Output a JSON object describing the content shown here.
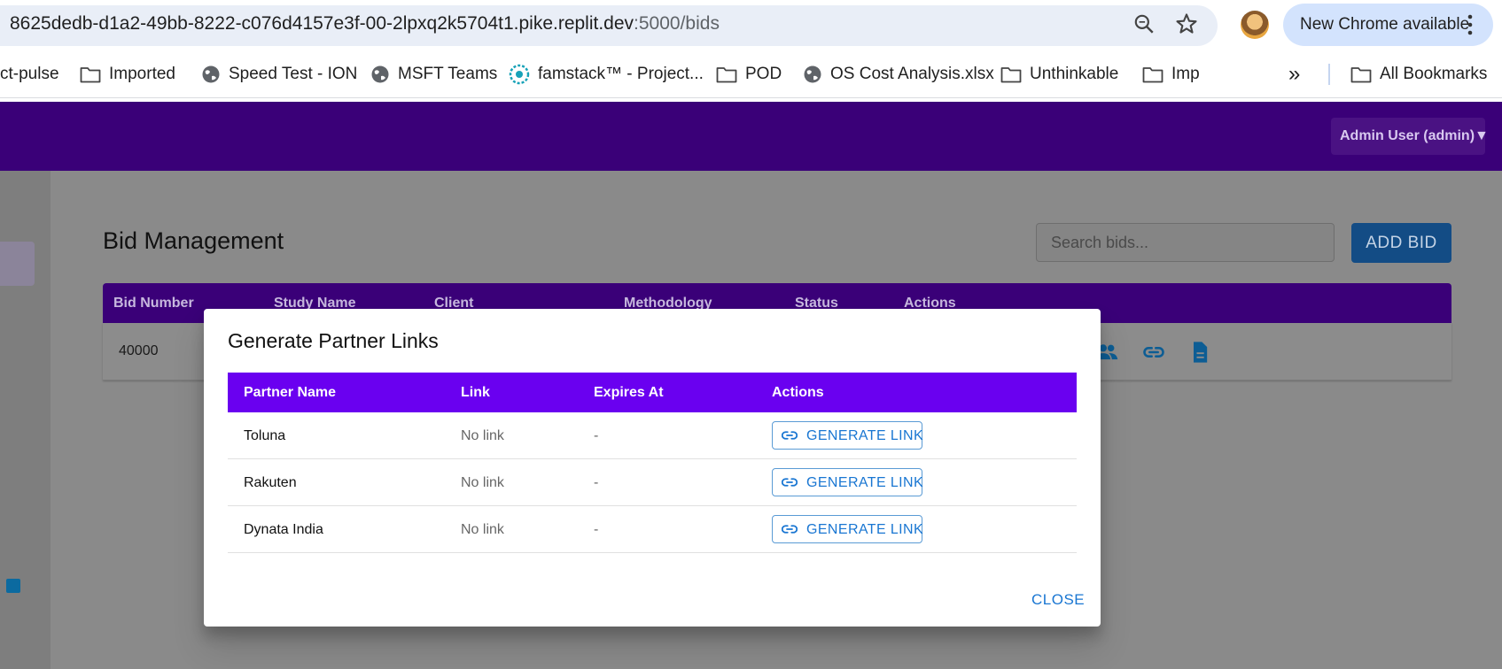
{
  "browser": {
    "url_host": "8625dedb-d1a2-49bb-8222-c076d4157e3f-00-2lpxq2k5704t1.pike.replit.dev",
    "url_path": ":5000/bids",
    "update_label": "New Chrome available",
    "bookmarks": [
      {
        "label": "ct-pulse",
        "icon": "none"
      },
      {
        "label": "Imported",
        "icon": "folder-icon"
      },
      {
        "label": "Speed Test - ION",
        "icon": "globe-icon"
      },
      {
        "label": "MSFT Teams",
        "icon": "globe-icon"
      },
      {
        "label": "famstack™ - Project...",
        "icon": "famstack-icon"
      },
      {
        "label": "POD",
        "icon": "folder-icon"
      },
      {
        "label": "OS Cost Analysis.xlsx",
        "icon": "globe-icon"
      },
      {
        "label": "Unthinkable",
        "icon": "folder-icon"
      },
      {
        "label": "Imp",
        "icon": "folder-icon"
      }
    ],
    "overflow_label": "»",
    "all_bookmarks_label": "All Bookmarks"
  },
  "header": {
    "user_menu_label": "Admin User (admin)▼"
  },
  "page": {
    "title": "Bid Management",
    "search_placeholder": "Search bids...",
    "add_bid_label": "ADD BID",
    "table": {
      "columns": [
        "Bid Number",
        "Study Name",
        "Client",
        "Methodology",
        "Status",
        "Actions"
      ],
      "rows": [
        {
          "bid_number": "40000"
        }
      ]
    }
  },
  "dialog": {
    "title": "Generate Partner Links",
    "columns": [
      "Partner Name",
      "Link",
      "Expires At",
      "Actions"
    ],
    "rows": [
      {
        "partner": "Toluna",
        "link": "No link",
        "expires": "-",
        "action": "GENERATE LINK"
      },
      {
        "partner": "Rakuten",
        "link": "No link",
        "expires": "-",
        "action": "GENERATE LINK"
      },
      {
        "partner": "Dynata India",
        "link": "No link",
        "expires": "-",
        "action": "GENERATE LINK"
      }
    ],
    "close_label": "CLOSE"
  },
  "colors": {
    "header_purple": "#3a0078",
    "dialog_header_purple": "#6a00f0",
    "link_blue": "#1976d2",
    "add_bid_blue": "#134c85"
  }
}
